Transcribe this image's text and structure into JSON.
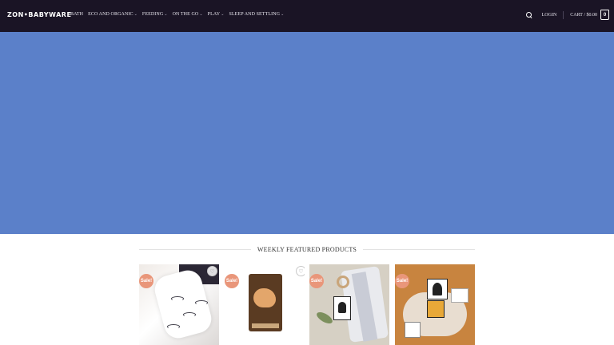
{
  "header": {
    "logo": "ZON•BABYWARE",
    "nav": [
      {
        "label": "BATH",
        "has_dropdown": false
      },
      {
        "label": "ECO AND ORGANIC",
        "has_dropdown": true
      },
      {
        "label": "FEEDING",
        "has_dropdown": true
      },
      {
        "label": "ON THE GO",
        "has_dropdown": true
      },
      {
        "label": "PLAY",
        "has_dropdown": true
      },
      {
        "label": "SLEEP AND SETTLING",
        "has_dropdown": true
      }
    ],
    "login_label": "LOGIN",
    "cart_label": "CART / $0.00",
    "cart_count": "0"
  },
  "hero": {
    "background_color": "#5b80c9"
  },
  "featured": {
    "title": "WEEKLY FEATURED PRODUCTS",
    "products": [
      {
        "badge": "Sale!",
        "wishlist_icon": "heart-icon"
      },
      {
        "badge": "Sale!",
        "wishlist_icon": "heart-icon"
      },
      {
        "badge": "Sale!",
        "wishlist_icon": "heart-icon"
      },
      {
        "badge": "Sale!",
        "wishlist_icon": "heart-icon"
      }
    ]
  },
  "colors": {
    "header_bg": "#1a1425",
    "sale_badge": "#e9967a"
  }
}
